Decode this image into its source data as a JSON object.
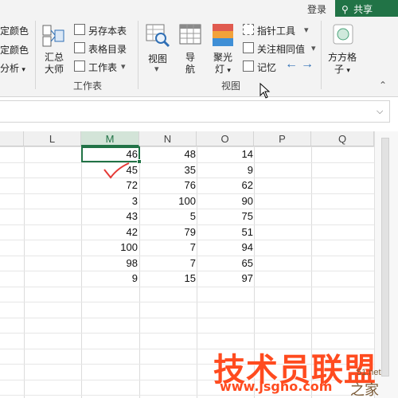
{
  "topbar": {
    "login": "登录",
    "share": "共享"
  },
  "ribbon": {
    "left_partial": {
      "item1": "定颜色",
      "item2": "定颜色",
      "item3": "分析"
    },
    "worksheet_group": {
      "summary_master": [
        "汇总",
        "大师"
      ],
      "save_sheet": "另存本表",
      "table_dir": "表格目录",
      "worksheet": "工作表",
      "label": "工作表"
    },
    "view_group": {
      "view": "视图",
      "nav": [
        "导",
        "航"
      ],
      "spotlight": [
        "聚光",
        "灯"
      ],
      "pointer_tool": "指针工具",
      "focus_same": "关注相同值",
      "memo": "记忆",
      "label": "视图"
    },
    "square_grid": [
      "方方格",
      "子"
    ]
  },
  "grid": {
    "columns": [
      "L",
      "M",
      "N",
      "O",
      "P",
      "Q"
    ],
    "active_column": "M",
    "rows": [
      [
        46,
        48,
        14
      ],
      [
        45,
        35,
        9
      ],
      [
        72,
        76,
        62
      ],
      [
        3,
        100,
        90
      ],
      [
        43,
        5,
        75
      ],
      [
        42,
        79,
        51
      ],
      [
        100,
        7,
        94
      ],
      [
        98,
        7,
        65
      ],
      [
        9,
        15,
        97
      ]
    ]
  },
  "watermark": {
    "title": "技术员联盟",
    "url": "www.jsgho.com",
    "side": "51.net",
    "home": "之家"
  },
  "colors": {
    "accent": "#217346",
    "watermark": "#ff4b1f",
    "annotation": "#e53935"
  }
}
